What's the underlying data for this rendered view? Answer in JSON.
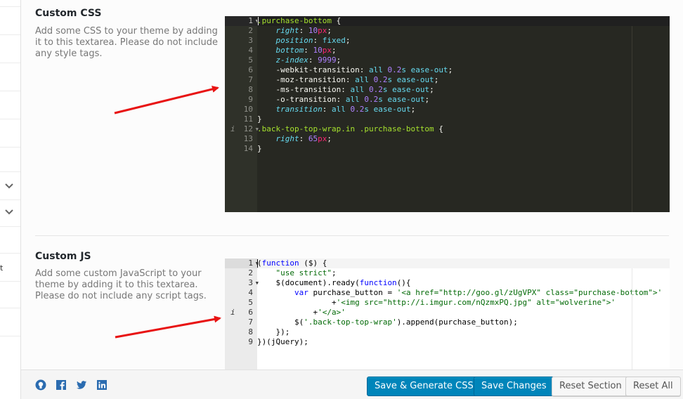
{
  "colors": {
    "primary_button": "#0085ba",
    "arrow": "#e81313",
    "css_editor_bg": "#272822",
    "js_editor_bg": "#ffffff"
  },
  "sidebar": {
    "chevrons": [
      "chevron-down-icon",
      "chevron-down-icon"
    ],
    "fragment": "t"
  },
  "custom_css": {
    "title": "Custom CSS",
    "description": "Add some CSS to your theme by adding it to this textarea. Please do not include any style tags.",
    "line_numbers": [
      "1",
      "2",
      "3",
      "4",
      "5",
      "6",
      "7",
      "8",
      "9",
      "10",
      "11",
      "12",
      "13",
      "14"
    ],
    "lines": [
      [
        {
          "t": ".purchase-bottom",
          "c": "tok-sel"
        },
        {
          "t": " {",
          "c": "tok-brace"
        }
      ],
      [
        {
          "t": "    ",
          "c": "tok-plain"
        },
        {
          "t": "right",
          "c": "tok-prop"
        },
        {
          "t": ": ",
          "c": "tok-plain"
        },
        {
          "t": "10",
          "c": "tok-num"
        },
        {
          "t": "px",
          "c": "tok-unit"
        },
        {
          "t": ";",
          "c": "tok-plain"
        }
      ],
      [
        {
          "t": "    ",
          "c": "tok-plain"
        },
        {
          "t": "position",
          "c": "tok-prop"
        },
        {
          "t": ": ",
          "c": "tok-plain"
        },
        {
          "t": "fixed",
          "c": "tok-kw"
        },
        {
          "t": ";",
          "c": "tok-plain"
        }
      ],
      [
        {
          "t": "    ",
          "c": "tok-plain"
        },
        {
          "t": "bottom",
          "c": "tok-prop"
        },
        {
          "t": ": ",
          "c": "tok-plain"
        },
        {
          "t": "10",
          "c": "tok-num"
        },
        {
          "t": "px",
          "c": "tok-unit"
        },
        {
          "t": ";",
          "c": "tok-plain"
        }
      ],
      [
        {
          "t": "    ",
          "c": "tok-plain"
        },
        {
          "t": "z-index",
          "c": "tok-prop"
        },
        {
          "t": ": ",
          "c": "tok-plain"
        },
        {
          "t": "9999",
          "c": "tok-num"
        },
        {
          "t": ";",
          "c": "tok-plain"
        }
      ],
      [
        {
          "t": "    -webkit-transition: ",
          "c": "tok-vendor"
        },
        {
          "t": "all",
          "c": "tok-kw"
        },
        {
          "t": " ",
          "c": "tok-plain"
        },
        {
          "t": "0.2",
          "c": "tok-num"
        },
        {
          "t": "s",
          "c": "tok-kw"
        },
        {
          "t": " ",
          "c": "tok-plain"
        },
        {
          "t": "ease-out",
          "c": "tok-kw"
        },
        {
          "t": ";",
          "c": "tok-plain"
        }
      ],
      [
        {
          "t": "    -moz-transition: ",
          "c": "tok-vendor"
        },
        {
          "t": "all",
          "c": "tok-kw"
        },
        {
          "t": " ",
          "c": "tok-plain"
        },
        {
          "t": "0.2",
          "c": "tok-num"
        },
        {
          "t": "s",
          "c": "tok-kw"
        },
        {
          "t": " ",
          "c": "tok-plain"
        },
        {
          "t": "ease-out",
          "c": "tok-kw"
        },
        {
          "t": ";",
          "c": "tok-plain"
        }
      ],
      [
        {
          "t": "    -ms-transition: ",
          "c": "tok-vendor"
        },
        {
          "t": "all",
          "c": "tok-kw"
        },
        {
          "t": " ",
          "c": "tok-plain"
        },
        {
          "t": "0.2",
          "c": "tok-num"
        },
        {
          "t": "s",
          "c": "tok-kw"
        },
        {
          "t": " ",
          "c": "tok-plain"
        },
        {
          "t": "ease-out",
          "c": "tok-kw"
        },
        {
          "t": ";",
          "c": "tok-plain"
        }
      ],
      [
        {
          "t": "    -o-transition: ",
          "c": "tok-vendor"
        },
        {
          "t": "all",
          "c": "tok-kw"
        },
        {
          "t": " ",
          "c": "tok-plain"
        },
        {
          "t": "0.2",
          "c": "tok-num"
        },
        {
          "t": "s",
          "c": "tok-kw"
        },
        {
          "t": " ",
          "c": "tok-plain"
        },
        {
          "t": "ease-out",
          "c": "tok-kw"
        },
        {
          "t": ";",
          "c": "tok-plain"
        }
      ],
      [
        {
          "t": "    ",
          "c": "tok-plain"
        },
        {
          "t": "transition",
          "c": "tok-prop"
        },
        {
          "t": ": ",
          "c": "tok-plain"
        },
        {
          "t": "all",
          "c": "tok-kw"
        },
        {
          "t": " ",
          "c": "tok-plain"
        },
        {
          "t": "0.2",
          "c": "tok-num"
        },
        {
          "t": "s",
          "c": "tok-kw"
        },
        {
          "t": " ",
          "c": "tok-plain"
        },
        {
          "t": "ease-out",
          "c": "tok-kw"
        },
        {
          "t": ";",
          "c": "tok-plain"
        }
      ],
      [
        {
          "t": "}",
          "c": "tok-brace"
        }
      ],
      [
        {
          "t": ".back-top-top-wrap.in .purchase-bottom",
          "c": "tok-sel"
        },
        {
          "t": " {",
          "c": "tok-brace"
        }
      ],
      [
        {
          "t": "    ",
          "c": "tok-plain"
        },
        {
          "t": "right",
          "c": "tok-prop"
        },
        {
          "t": ": ",
          "c": "tok-plain"
        },
        {
          "t": "65",
          "c": "tok-num"
        },
        {
          "t": "px",
          "c": "tok-unit"
        },
        {
          "t": ";",
          "c": "tok-plain"
        }
      ],
      [
        {
          "t": "}",
          "c": "tok-brace"
        }
      ]
    ]
  },
  "custom_js": {
    "title": "Custom JS",
    "description": "Add some custom JavaScript to your theme by adding it to this textarea. Please do not include any script tags.",
    "line_numbers": [
      "1",
      "2",
      "3",
      "4",
      "5",
      "6",
      "7",
      "8",
      "9"
    ],
    "lines": [
      [
        {
          "t": "(",
          "c": "jtok-punc"
        },
        {
          "t": "function",
          "c": "jtok-kw"
        },
        {
          "t": " ($) {",
          "c": "jtok-punc"
        }
      ],
      [
        {
          "t": "    ",
          "c": "jtok-punc"
        },
        {
          "t": "\"use strict\"",
          "c": "jtok-str"
        },
        {
          "t": ";",
          "c": "jtok-punc"
        }
      ],
      [
        {
          "t": "    $(document).ready(",
          "c": "jtok-punc"
        },
        {
          "t": "function",
          "c": "jtok-kw"
        },
        {
          "t": "(){",
          "c": "jtok-punc"
        }
      ],
      [
        {
          "t": "        ",
          "c": "jtok-punc"
        },
        {
          "t": "var",
          "c": "jtok-kw"
        },
        {
          "t": " purchase_button = ",
          "c": "jtok-punc"
        },
        {
          "t": "'<a href=\"http://goo.gl/zUgVPX\" class=\"purchase-bottom\">'",
          "c": "jtok-str"
        }
      ],
      [
        {
          "t": "                +",
          "c": "jtok-punc"
        },
        {
          "t": "'<img src=\"http://i.imgur.com/nQzmxPQ.jpg\" alt=\"wolverine\">'",
          "c": "jtok-str"
        }
      ],
      [
        {
          "t": "            +",
          "c": "jtok-punc"
        },
        {
          "t": "'</a>'",
          "c": "jtok-str"
        }
      ],
      [
        {
          "t": "        $(",
          "c": "jtok-punc"
        },
        {
          "t": "'.back-top-top-wrap'",
          "c": "jtok-str"
        },
        {
          "t": ").append(purchase_button);",
          "c": "jtok-punc"
        }
      ],
      [
        {
          "t": "    });",
          "c": "jtok-punc"
        }
      ],
      [
        {
          "t": "})(jQuery);",
          "c": "jtok-punc"
        }
      ]
    ]
  },
  "footer": {
    "social_icons": [
      "github-icon",
      "facebook-icon",
      "twitter-icon",
      "linkedin-icon"
    ],
    "save_generate_label": "Save & Generate CSS",
    "save_changes_label": "Save Changes",
    "reset_section_label": "Reset Section",
    "reset_all_label": "Reset All"
  }
}
